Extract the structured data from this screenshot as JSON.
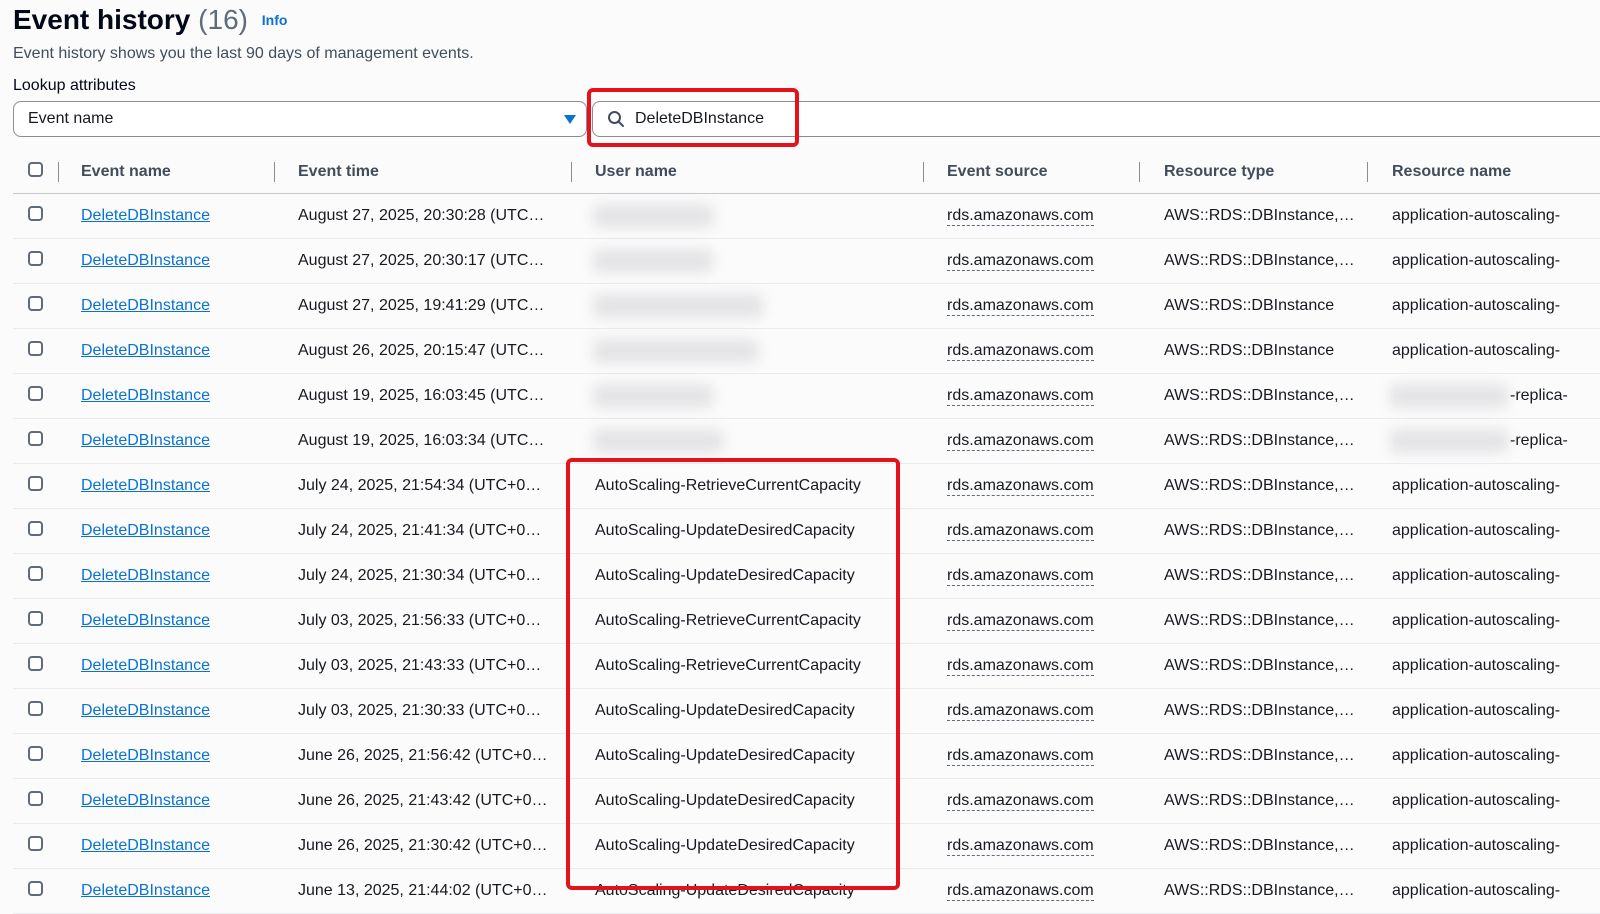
{
  "header": {
    "title": "Event history",
    "count": "(16)",
    "info_link": "Info",
    "subtitle": "Event history shows you the last 90 days of management events."
  },
  "lookup": {
    "label": "Lookup attributes",
    "attribute_selected": "Event name",
    "search_value": "DeleteDBInstance"
  },
  "table": {
    "columns": [
      "Event name",
      "Event time",
      "User name",
      "Event source",
      "Resource type",
      "Resource name"
    ],
    "rows": [
      {
        "event_name": "DeleteDBInstance",
        "event_time": "August 27, 2025, 20:30:28 (UTC…",
        "user_name": "",
        "event_source": "rds.amazonaws.com",
        "resource_type": "AWS::RDS::DBInstance,…",
        "resource_name": "application-autoscaling-"
      },
      {
        "event_name": "DeleteDBInstance",
        "event_time": "August 27, 2025, 20:30:17 (UTC…",
        "user_name": "",
        "event_source": "rds.amazonaws.com",
        "resource_type": "AWS::RDS::DBInstance,…",
        "resource_name": "application-autoscaling-"
      },
      {
        "event_name": "DeleteDBInstance",
        "event_time": "August 27, 2025, 19:41:29 (UTC…",
        "user_name": "",
        "event_source": "rds.amazonaws.com",
        "resource_type": "AWS::RDS::DBInstance",
        "resource_name": "application-autoscaling-"
      },
      {
        "event_name": "DeleteDBInstance",
        "event_time": "August 26, 2025, 20:15:47 (UTC…",
        "user_name": "",
        "event_source": "rds.amazonaws.com",
        "resource_type": "AWS::RDS::DBInstance",
        "resource_name": "application-autoscaling-"
      },
      {
        "event_name": "DeleteDBInstance",
        "event_time": "August 19, 2025, 16:03:45 (UTC…",
        "user_name": "",
        "event_source": "rds.amazonaws.com",
        "resource_type": "AWS::RDS::DBInstance,…",
        "resource_name": "-replica-"
      },
      {
        "event_name": "DeleteDBInstance",
        "event_time": "August 19, 2025, 16:03:34 (UTC…",
        "user_name": "",
        "event_source": "rds.amazonaws.com",
        "resource_type": "AWS::RDS::DBInstance,…",
        "resource_name": "-replica-"
      },
      {
        "event_name": "DeleteDBInstance",
        "event_time": "July 24, 2025, 21:54:34 (UTC+0…",
        "user_name": "AutoScaling-RetrieveCurrentCapacity",
        "event_source": "rds.amazonaws.com",
        "resource_type": "AWS::RDS::DBInstance,…",
        "resource_name": "application-autoscaling-"
      },
      {
        "event_name": "DeleteDBInstance",
        "event_time": "July 24, 2025, 21:41:34 (UTC+0…",
        "user_name": "AutoScaling-UpdateDesiredCapacity",
        "event_source": "rds.amazonaws.com",
        "resource_type": "AWS::RDS::DBInstance,…",
        "resource_name": "application-autoscaling-"
      },
      {
        "event_name": "DeleteDBInstance",
        "event_time": "July 24, 2025, 21:30:34 (UTC+0…",
        "user_name": "AutoScaling-UpdateDesiredCapacity",
        "event_source": "rds.amazonaws.com",
        "resource_type": "AWS::RDS::DBInstance,…",
        "resource_name": "application-autoscaling-"
      },
      {
        "event_name": "DeleteDBInstance",
        "event_time": "July 03, 2025, 21:56:33 (UTC+0…",
        "user_name": "AutoScaling-RetrieveCurrentCapacity",
        "event_source": "rds.amazonaws.com",
        "resource_type": "AWS::RDS::DBInstance,…",
        "resource_name": "application-autoscaling-"
      },
      {
        "event_name": "DeleteDBInstance",
        "event_time": "July 03, 2025, 21:43:33 (UTC+0…",
        "user_name": "AutoScaling-RetrieveCurrentCapacity",
        "event_source": "rds.amazonaws.com",
        "resource_type": "AWS::RDS::DBInstance,…",
        "resource_name": "application-autoscaling-"
      },
      {
        "event_name": "DeleteDBInstance",
        "event_time": "July 03, 2025, 21:30:33 (UTC+0…",
        "user_name": "AutoScaling-UpdateDesiredCapacity",
        "event_source": "rds.amazonaws.com",
        "resource_type": "AWS::RDS::DBInstance,…",
        "resource_name": "application-autoscaling-"
      },
      {
        "event_name": "DeleteDBInstance",
        "event_time": "June 26, 2025, 21:56:42 (UTC+0…",
        "user_name": "AutoScaling-UpdateDesiredCapacity",
        "event_source": "rds.amazonaws.com",
        "resource_type": "AWS::RDS::DBInstance,…",
        "resource_name": "application-autoscaling-"
      },
      {
        "event_name": "DeleteDBInstance",
        "event_time": "June 26, 2025, 21:43:42 (UTC+0…",
        "user_name": "AutoScaling-UpdateDesiredCapacity",
        "event_source": "rds.amazonaws.com",
        "resource_type": "AWS::RDS::DBInstance,…",
        "resource_name": "application-autoscaling-"
      },
      {
        "event_name": "DeleteDBInstance",
        "event_time": "June 26, 2025, 21:30:42 (UTC+0…",
        "user_name": "AutoScaling-UpdateDesiredCapacity",
        "event_source": "rds.amazonaws.com",
        "resource_type": "AWS::RDS::DBInstance,…",
        "resource_name": "application-autoscaling-"
      },
      {
        "event_name": "DeleteDBInstance",
        "event_time": "June 13, 2025, 21:44:02 (UTC+0…",
        "user_name": "AutoScaling-UpdateDesiredCapacity",
        "event_source": "rds.amazonaws.com",
        "resource_type": "AWS::RDS::DBInstance,…",
        "resource_name": "application-autoscaling-"
      }
    ]
  },
  "colors": {
    "link": "#0972d3",
    "highlight": "#e3121b"
  }
}
